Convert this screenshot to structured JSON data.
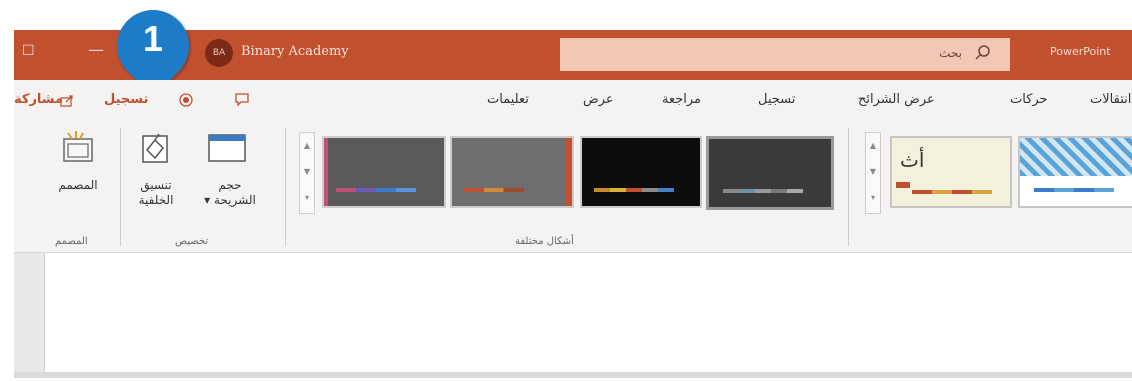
{
  "callout": {
    "number": "1"
  },
  "titlebar": {
    "account_initials": "BA",
    "account_name": "Binary Academy",
    "search_placeholder": "بحث",
    "app_name": "PowerPoint"
  },
  "tabs": {
    "share": "مشاركة",
    "record": "تسجيل",
    "comments_icon": "comment-icon",
    "help": "تعليمات",
    "view": "عرض",
    "review": "مراجعة",
    "recording": "تسجيل",
    "slideshow": "عرض الشرائح",
    "animations": "حركات",
    "transitions": "انتقالات"
  },
  "ribbon": {
    "designer_button": "المصمم",
    "designer_group": "المصمم",
    "format_background_line1": "تنسيق",
    "format_background_line2": "الخلفية",
    "slide_size_line1": "حجم",
    "slide_size_line2": "الشريحة",
    "customize_group": "تخصيص",
    "variants_group": "أشكال مختلفة",
    "theme_preview_text": "أث"
  },
  "colors": {
    "accent": "#c1502f",
    "callout": "#1c7cc8"
  }
}
